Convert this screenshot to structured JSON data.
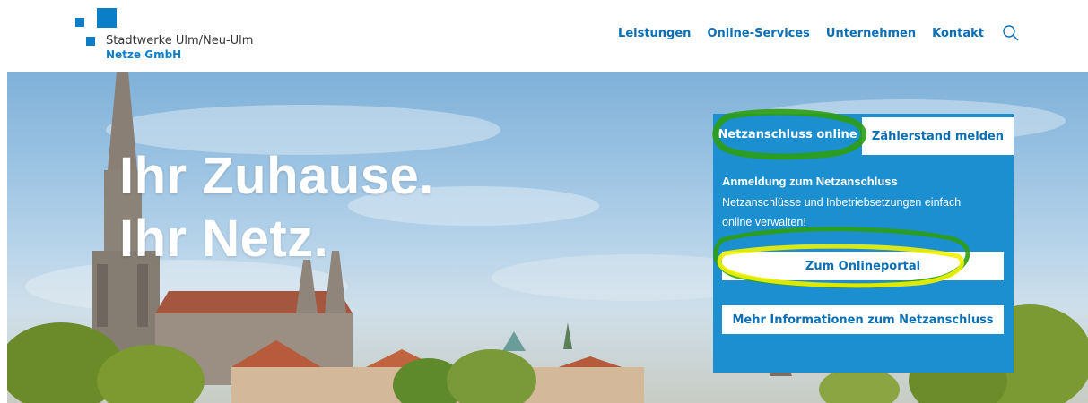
{
  "header": {
    "logo_line1": "Stadtwerke Ulm/Neu-Ulm",
    "logo_line2": "Netze GmbH",
    "nav": [
      "Leistungen",
      "Online-Services",
      "Unternehmen",
      "Kontakt"
    ],
    "search_icon": "search-icon"
  },
  "hero": {
    "headline_line1": "Ihr Zuhause.",
    "headline_line2": "Ihr Netz."
  },
  "panel": {
    "tabs": [
      {
        "label": "Netzanschluss online",
        "active": true
      },
      {
        "label": "Zählerstand melden",
        "active": false
      }
    ],
    "title": "Anmeldung zum Netzanschluss",
    "text": "Netzanschlüsse und Inbetriebsetzungen einfach online verwalten!",
    "portal_button": "Zum Onlineportal",
    "info_button": "Mehr Informationen zum Netzanschluss"
  },
  "colors": {
    "brand_blue": "#0a7fc8",
    "panel_blue": "#1c8fd1",
    "highlight_green": "#2e9e12",
    "highlight_yellow": "#f2f200"
  }
}
